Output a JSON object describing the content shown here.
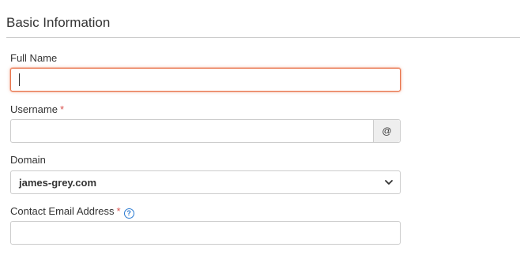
{
  "section": {
    "title": "Basic Information"
  },
  "fields": {
    "full_name": {
      "label": "Full Name",
      "value": ""
    },
    "username": {
      "label": "Username",
      "required_marker": "*",
      "value": "",
      "addon": "@"
    },
    "domain": {
      "label": "Domain",
      "selected": "james-grey.com"
    },
    "contact_email": {
      "label": "Contact Email Address",
      "required_marker": "*",
      "help_icon": "?",
      "value": ""
    }
  },
  "colors": {
    "focus_border": "#e8734a",
    "required": "#d9534f",
    "help": "#2a7ad1",
    "addon_bg": "#eeeeee"
  },
  "icons": {
    "select": "chevron-down-icon",
    "help": "help-circle-icon"
  }
}
